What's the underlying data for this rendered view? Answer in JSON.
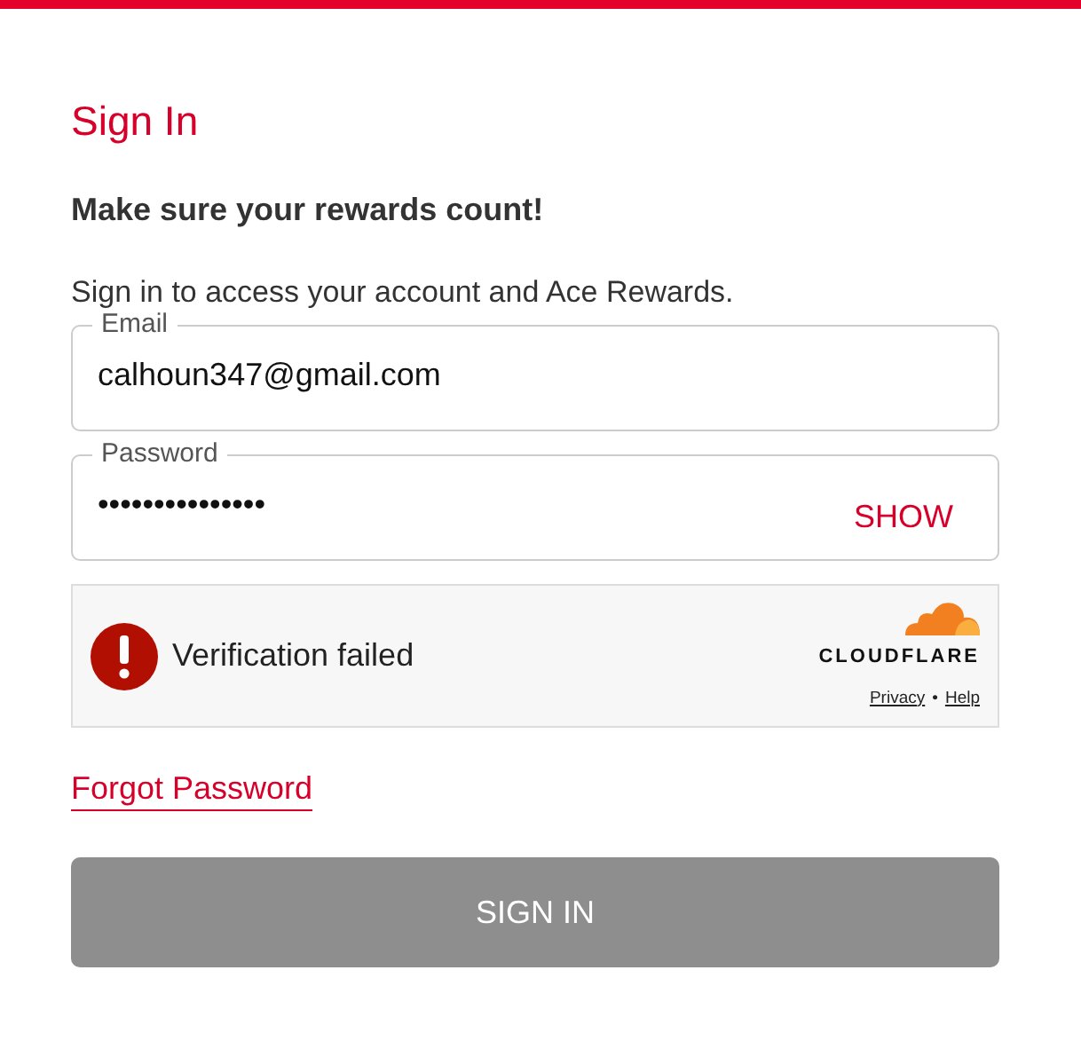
{
  "heading": "Sign In",
  "subheading": "Make sure your rewards count!",
  "intro": "Sign in to access your account and Ace Rewards.",
  "email": {
    "label": "Email",
    "value": "calhoun347@gmail.com"
  },
  "password": {
    "label": "Password",
    "value": "•••••••••••••••",
    "toggle": "SHOW"
  },
  "verification": {
    "status": "Verification failed",
    "brand": "CLOUDFLARE",
    "links": [
      "Privacy",
      "Help"
    ],
    "separator": "•"
  },
  "forgot_link": "Forgot Password",
  "sign_in_button": {
    "label": "SIGN IN",
    "disabled": true
  }
}
